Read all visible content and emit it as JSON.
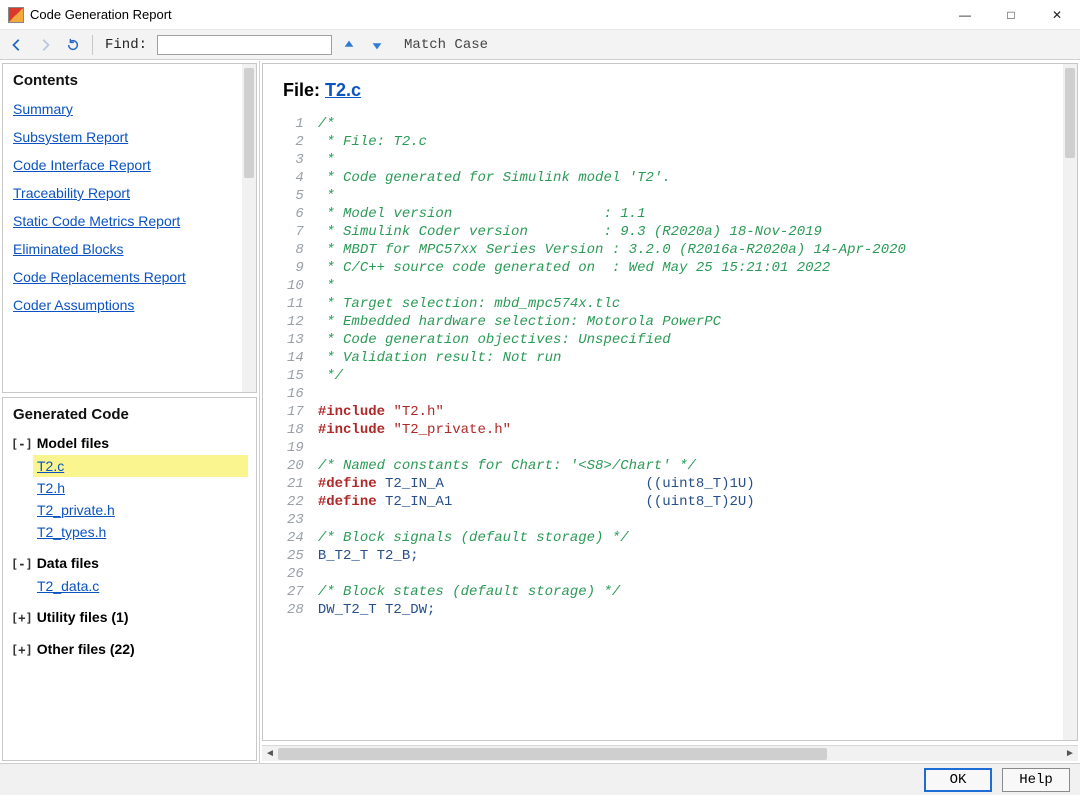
{
  "window": {
    "title": "Code Generation Report"
  },
  "toolbar": {
    "find_label": "Find:",
    "find_value": "",
    "match_case": "Match Case"
  },
  "contents": {
    "header": "Contents",
    "links": [
      "Summary",
      "Subsystem Report",
      "Code Interface Report",
      "Traceability Report",
      "Static Code Metrics Report",
      "Eliminated Blocks",
      "Code Replacements Report",
      "Coder Assumptions"
    ]
  },
  "generated": {
    "header": "Generated Code",
    "sections": [
      {
        "label": "Model files",
        "toggle": "[-]",
        "files": [
          "T2.c",
          "T2.h",
          "T2_private.h",
          "T2_types.h"
        ],
        "selected": "T2.c"
      },
      {
        "label": "Data files",
        "toggle": "[-]",
        "files": [
          "T2_data.c"
        ]
      },
      {
        "label": "Utility files (1)",
        "toggle": "[+]",
        "files": []
      },
      {
        "label": "Other files (22)",
        "toggle": "[+]",
        "files": []
      }
    ]
  },
  "file": {
    "label": "File: ",
    "name": "T2.c"
  },
  "code": [
    {
      "n": 1,
      "tokens": [
        {
          "t": "/*",
          "c": "cmt"
        }
      ]
    },
    {
      "n": 2,
      "tokens": [
        {
          "t": " * File: T2.c",
          "c": "cmt"
        }
      ]
    },
    {
      "n": 3,
      "tokens": [
        {
          "t": " *",
          "c": "cmt"
        }
      ]
    },
    {
      "n": 4,
      "tokens": [
        {
          "t": " * Code generated for Simulink model 'T2'.",
          "c": "cmt"
        }
      ]
    },
    {
      "n": 5,
      "tokens": [
        {
          "t": " *",
          "c": "cmt"
        }
      ]
    },
    {
      "n": 6,
      "tokens": [
        {
          "t": " * Model version                  : 1.1",
          "c": "cmt"
        }
      ]
    },
    {
      "n": 7,
      "tokens": [
        {
          "t": " * Simulink Coder version         : 9.3 (R2020a) 18-Nov-2019",
          "c": "cmt"
        }
      ]
    },
    {
      "n": 8,
      "tokens": [
        {
          "t": " * MBDT for MPC57xx Series Version : 3.2.0 (R2016a-R2020a) 14-Apr-2020",
          "c": "cmt"
        }
      ]
    },
    {
      "n": 9,
      "tokens": [
        {
          "t": " * C/C++ source code generated on  : Wed May 25 15:21:01 2022",
          "c": "cmt"
        }
      ]
    },
    {
      "n": 10,
      "tokens": [
        {
          "t": " *",
          "c": "cmt"
        }
      ]
    },
    {
      "n": 11,
      "tokens": [
        {
          "t": " * Target selection: mbd_mpc574x.tlc",
          "c": "cmt"
        }
      ]
    },
    {
      "n": 12,
      "tokens": [
        {
          "t": " * Embedded hardware selection: Motorola PowerPC",
          "c": "cmt"
        }
      ]
    },
    {
      "n": 13,
      "tokens": [
        {
          "t": " * Code generation objectives: Unspecified",
          "c": "cmt"
        }
      ]
    },
    {
      "n": 14,
      "tokens": [
        {
          "t": " * Validation result: Not run",
          "c": "cmt"
        }
      ]
    },
    {
      "n": 15,
      "tokens": [
        {
          "t": " */",
          "c": "cmt"
        }
      ]
    },
    {
      "n": 16,
      "tokens": [
        {
          "t": "",
          "c": "plain"
        }
      ]
    },
    {
      "n": 17,
      "tokens": [
        {
          "t": "#include ",
          "c": "kw"
        },
        {
          "t": "\"T2.h\"",
          "c": "str"
        }
      ]
    },
    {
      "n": 18,
      "tokens": [
        {
          "t": "#include ",
          "c": "kw"
        },
        {
          "t": "\"T2_private.h\"",
          "c": "str"
        }
      ]
    },
    {
      "n": 19,
      "tokens": [
        {
          "t": "",
          "c": "plain"
        }
      ]
    },
    {
      "n": 20,
      "tokens": [
        {
          "t": "/* Named constants for Chart: '<S8>/Chart' */",
          "c": "cmt"
        }
      ]
    },
    {
      "n": 21,
      "tokens": [
        {
          "t": "#define ",
          "c": "kw"
        },
        {
          "t": "T2_IN_A                        ",
          "c": "idn"
        },
        {
          "t": "((uint8_T)1U)",
          "c": "plain"
        }
      ]
    },
    {
      "n": 22,
      "tokens": [
        {
          "t": "#define ",
          "c": "kw"
        },
        {
          "t": "T2_IN_A1                       ",
          "c": "idn"
        },
        {
          "t": "((uint8_T)2U)",
          "c": "plain"
        }
      ]
    },
    {
      "n": 23,
      "tokens": [
        {
          "t": "",
          "c": "plain"
        }
      ]
    },
    {
      "n": 24,
      "tokens": [
        {
          "t": "/* Block signals (default storage) */",
          "c": "cmt"
        }
      ]
    },
    {
      "n": 25,
      "tokens": [
        {
          "t": "B_T2_T T2_B;",
          "c": "plain"
        }
      ]
    },
    {
      "n": 26,
      "tokens": [
        {
          "t": "",
          "c": "plain"
        }
      ]
    },
    {
      "n": 27,
      "tokens": [
        {
          "t": "/* Block states (default storage) */",
          "c": "cmt"
        }
      ]
    },
    {
      "n": 28,
      "tokens": [
        {
          "t": "DW_T2_T T2_DW;",
          "c": "plain"
        }
      ]
    }
  ],
  "footer": {
    "ok": "OK",
    "help": "Help"
  }
}
